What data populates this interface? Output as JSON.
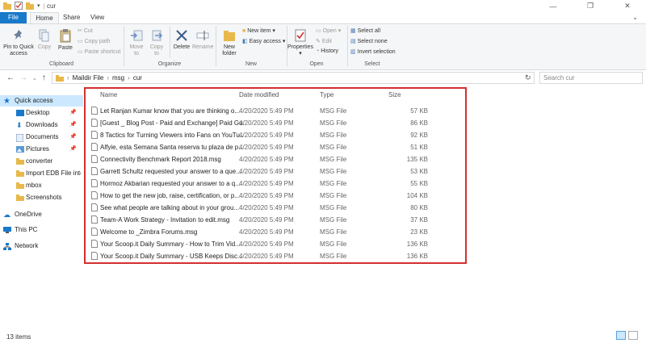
{
  "window": {
    "title": "cur",
    "controls": [
      "—",
      "❐",
      "✕"
    ]
  },
  "ribbon_tabs": [
    {
      "label": "File"
    },
    {
      "label": "Home"
    },
    {
      "label": "Share"
    },
    {
      "label": "View"
    }
  ],
  "ribbon": {
    "clipboard": {
      "pin_label": "Pin to Quick access",
      "copy": "Copy",
      "paste": "Paste",
      "cut": "Cut",
      "copy_path": "Copy path",
      "paste_shortcut": "Paste shortcut",
      "group": "Clipboard"
    },
    "organize": {
      "move_to": "Move to",
      "copy_to": "Copy to",
      "delete": "Delete",
      "rename": "Rename",
      "group": "Organize"
    },
    "new": {
      "new_folder": "New folder",
      "new_item": "New item",
      "easy_access": "Easy access",
      "group": "New"
    },
    "open": {
      "properties": "Properties",
      "open": "Open",
      "edit": "Edit",
      "history": "History",
      "group": "Open"
    },
    "select": {
      "select_all": "Select all",
      "select_none": "Select none",
      "invert_selection": "Invert selection",
      "group": "Select"
    }
  },
  "address": {
    "path": [
      "Maildir File",
      "msg",
      "cur"
    ],
    "search_placeholder": "Search cur"
  },
  "navigation": [
    {
      "label": "Quick access",
      "pinned": false
    },
    {
      "label": "Desktop",
      "pinned": true
    },
    {
      "label": "Downloads",
      "pinned": true
    },
    {
      "label": "Documents",
      "pinned": true
    },
    {
      "label": "Pictures",
      "pinned": true
    },
    {
      "label": "converter",
      "pinned": false
    },
    {
      "label": "Import EDB File into",
      "pinned": false
    },
    {
      "label": "mbox",
      "pinned": false
    },
    {
      "label": "Screenshots",
      "pinned": false
    },
    {
      "label": "OneDrive",
      "pinned": false
    },
    {
      "label": "This PC",
      "pinned": false
    },
    {
      "label": "Network",
      "pinned": false
    }
  ],
  "columns": {
    "name": "Name",
    "date": "Date modified",
    "type": "Type",
    "size": "Size"
  },
  "files": [
    {
      "name": "Let Ranjan Kumar know that you are thinking o...",
      "date": "4/20/2020 5:49 PM",
      "type": "MSG File",
      "size": "57 KB"
    },
    {
      "name": "[Guest _ Blog Post - Paid and Exchange] Paid Gu...",
      "date": "4/20/2020 5:49 PM",
      "type": "MSG File",
      "size": "86 KB"
    },
    {
      "name": "8 Tactics for Turning Viewers into Fans on YouTu...",
      "date": "4/20/2020 5:49 PM",
      "type": "MSG File",
      "size": "92 KB"
    },
    {
      "name": "Alfyie, esta Semana Santa reserva tu plaza de p...",
      "date": "4/20/2020 5:49 PM",
      "type": "MSG File",
      "size": "51 KB"
    },
    {
      "name": "Connectivity Benchmark Report 2018.msg",
      "date": "4/20/2020 5:49 PM",
      "type": "MSG File",
      "size": "135 KB"
    },
    {
      "name": "Garrett Schultz requested your answer to a que...",
      "date": "4/20/2020 5:49 PM",
      "type": "MSG File",
      "size": "53 KB"
    },
    {
      "name": "Hormoz Akbarian requested your answer to a q...",
      "date": "4/20/2020 5:49 PM",
      "type": "MSG File",
      "size": "55 KB"
    },
    {
      "name": "How to get the new job, raise, certification, or p...",
      "date": "4/20/2020 5:49 PM",
      "type": "MSG File",
      "size": "104 KB"
    },
    {
      "name": "See what people are talking about in your grou...",
      "date": "4/20/2020 5:49 PM",
      "type": "MSG File",
      "size": "80 KB"
    },
    {
      "name": "Team-A Work Strategy - Invitation to edit.msg",
      "date": "4/20/2020 5:49 PM",
      "type": "MSG File",
      "size": "37 KB"
    },
    {
      "name": "Welcome to _Zimbra Forums.msg",
      "date": "4/20/2020 5:49 PM",
      "type": "MSG File",
      "size": "23 KB"
    },
    {
      "name": "Your Scoop.it Daily Summary - How to Trim Vid...",
      "date": "4/20/2020 5:49 PM",
      "type": "MSG File",
      "size": "136 KB"
    },
    {
      "name": "Your Scoop.it Daily Summary - USB Keeps Disc...",
      "date": "4/20/2020 5:49 PM",
      "type": "MSG File",
      "size": "136 KB"
    }
  ],
  "status": {
    "item_count": "13 items"
  },
  "colors": {
    "accent": "#1979ca",
    "selection": "#cce8ff",
    "highlight_box": "#d32f2f",
    "folder": "#e8b84a"
  }
}
